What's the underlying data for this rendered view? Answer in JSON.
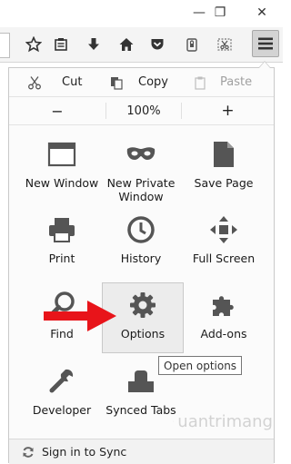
{
  "window": {
    "controls": {
      "minimize": "—",
      "restore": "❐",
      "close": "✕"
    }
  },
  "toolbar": {
    "icons": [
      "star-icon",
      "reading-list-icon",
      "download-icon",
      "home-icon",
      "pocket-icon",
      "lock-icon",
      "screenshot-icon"
    ],
    "menu_icon": "hamburger-icon"
  },
  "menu": {
    "edit": {
      "cut": "Cut",
      "copy": "Copy",
      "paste": "Paste"
    },
    "zoom": {
      "minus": "−",
      "level": "100%",
      "plus": "+"
    },
    "tiles": [
      {
        "label": "New Window",
        "icon": "window-icon"
      },
      {
        "label": "New Private\nWindow",
        "icon": "mask-icon"
      },
      {
        "label": "Save Page",
        "icon": "page-icon"
      },
      {
        "label": "Print",
        "icon": "printer-icon"
      },
      {
        "label": "History",
        "icon": "clock-icon"
      },
      {
        "label": "Full Screen",
        "icon": "fullscreen-icon"
      },
      {
        "label": "Find",
        "icon": "magnifier-icon"
      },
      {
        "label": "Options",
        "icon": "gear-icon"
      },
      {
        "label": "Add-ons",
        "icon": "puzzle-icon"
      },
      {
        "label": "Developer",
        "icon": "wrench-icon"
      },
      {
        "label": "Synced Tabs",
        "icon": "synced-tabs-icon"
      }
    ],
    "tooltip": "Open options",
    "footer": "Sign in to Sync"
  },
  "annotation": {
    "arrow_color": "#e8141a"
  },
  "watermark": {
    "text": "uantrimang"
  },
  "colors": {
    "hover_tile": "#ececec",
    "menu_button": "#d3d3d3"
  }
}
